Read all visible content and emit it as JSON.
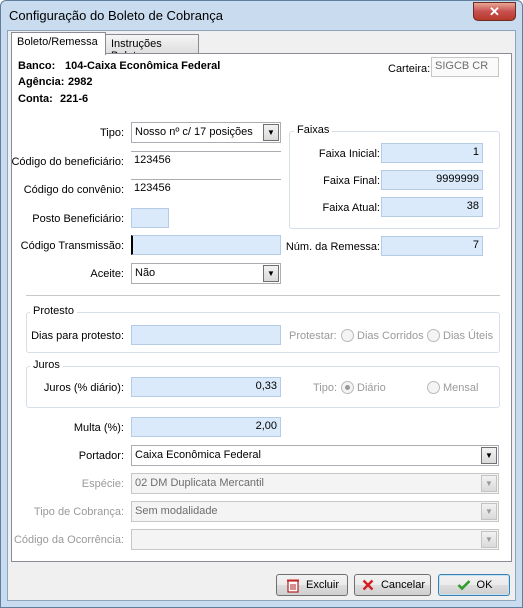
{
  "window": {
    "title": "Configuração do Boleto de Cobrança",
    "close_glyph": "✕"
  },
  "tabs": [
    {
      "label": "Boleto/Remessa",
      "active": true
    },
    {
      "label": "Instruções Boleto",
      "active": false
    }
  ],
  "header": {
    "banco_label": "Banco:",
    "banco_value": "104-Caixa Econômica Federal",
    "agencia_label": "Agência:",
    "agencia_value": "2982",
    "conta_label": "Conta:",
    "conta_value": "221-6",
    "carteira_label": "Carteira:",
    "carteira_value": "SIGCB CR"
  },
  "form": {
    "tipo_label": "Tipo:",
    "tipo_value": "Nosso nº c/ 17 posições",
    "beneficiario_label": "Código do beneficiário:",
    "beneficiario_value": "123456",
    "convenio_label": "Código do convênio:",
    "convenio_value": "123456",
    "posto_label": "Posto Beneficiário:",
    "posto_value": "",
    "transmissao_label": "Código Transmissão:",
    "transmissao_value": "",
    "aceite_label": "Aceite:",
    "aceite_value": "Não"
  },
  "faixas": {
    "legend": "Faixas",
    "inicial_label": "Faixa Inicial:",
    "inicial_value": "1",
    "final_label": "Faixa Final:",
    "final_value": "9999999",
    "atual_label": "Faixa Atual:",
    "atual_value": "38"
  },
  "remessa": {
    "label": "Núm. da Remessa:",
    "value": "7"
  },
  "protesto": {
    "legend": "Protesto",
    "dias_label": "Dias para protesto:",
    "dias_value": "",
    "protestar_label": "Protestar:",
    "opt_corridos": "Dias Corridos",
    "opt_uteis": "Dias Úteis"
  },
  "juros": {
    "legend": "Juros",
    "label": "Juros (% diário):",
    "value": "0,33",
    "tipo_label": "Tipo:",
    "opt_diario": "Diário",
    "opt_mensal": "Mensal",
    "selected": "Diário"
  },
  "multa": {
    "label": "Multa (%):",
    "value": "2,00"
  },
  "portador": {
    "label": "Portador:",
    "value": "Caixa Econômica Federal"
  },
  "especie": {
    "label": "Espécie:",
    "value": "02 DM Duplicata Mercantil"
  },
  "tipo_cobranca": {
    "label": "Tipo de Cobrança:",
    "value": "Sem modalidade"
  },
  "codigo_ocorrencia": {
    "label": "Código da Ocorrência:",
    "value": ""
  },
  "buttons": {
    "excluir": "Excluir",
    "cancelar": "Cancelar",
    "ok": "OK"
  },
  "icons": {
    "dropdown": "chevron-down-icon",
    "excluir": "trash-icon",
    "cancelar": "x-icon",
    "ok": "check-icon"
  },
  "colors": {
    "field_blue": "#dbeafb",
    "title_bar": "#c9dbee",
    "close_red": "#c75050",
    "cancel_red": "#d42020",
    "ok_green": "#2f9e2f"
  }
}
